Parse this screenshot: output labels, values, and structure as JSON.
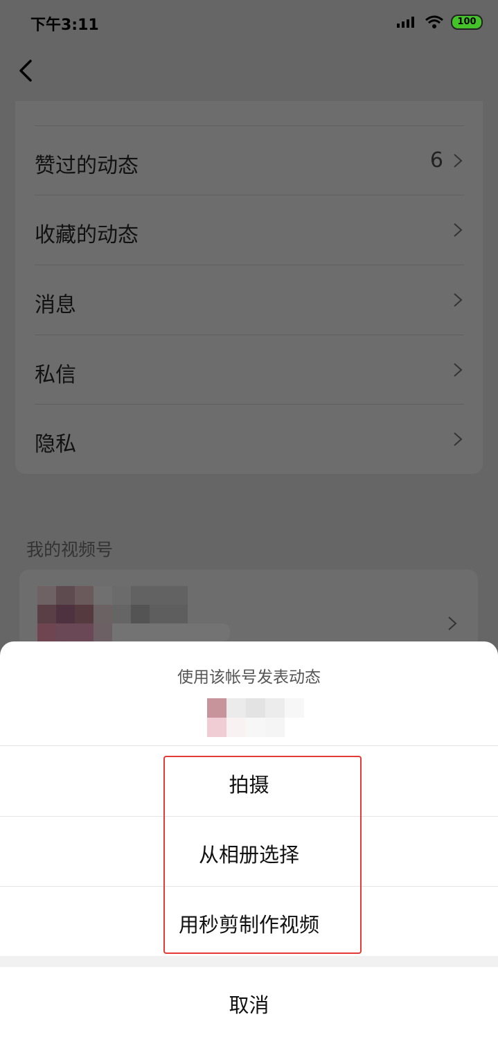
{
  "status_bar": {
    "time": "下午3:11",
    "battery": "100"
  },
  "menu": {
    "items": [
      {
        "label": "赞过的动态",
        "count": "6"
      },
      {
        "label": "收藏的动态",
        "count": ""
      },
      {
        "label": "消息",
        "count": ""
      },
      {
        "label": "私信",
        "count": ""
      },
      {
        "label": "隐私",
        "count": ""
      }
    ]
  },
  "channels": {
    "section_title": "我的视频号"
  },
  "sheet": {
    "title": "使用该帐号发表动态",
    "options": [
      "拍摄",
      "从相册选择",
      "用秒剪制作视频"
    ],
    "cancel": "取消"
  },
  "colors": {
    "highlight": "#e53935",
    "battery": "#43c22a"
  }
}
